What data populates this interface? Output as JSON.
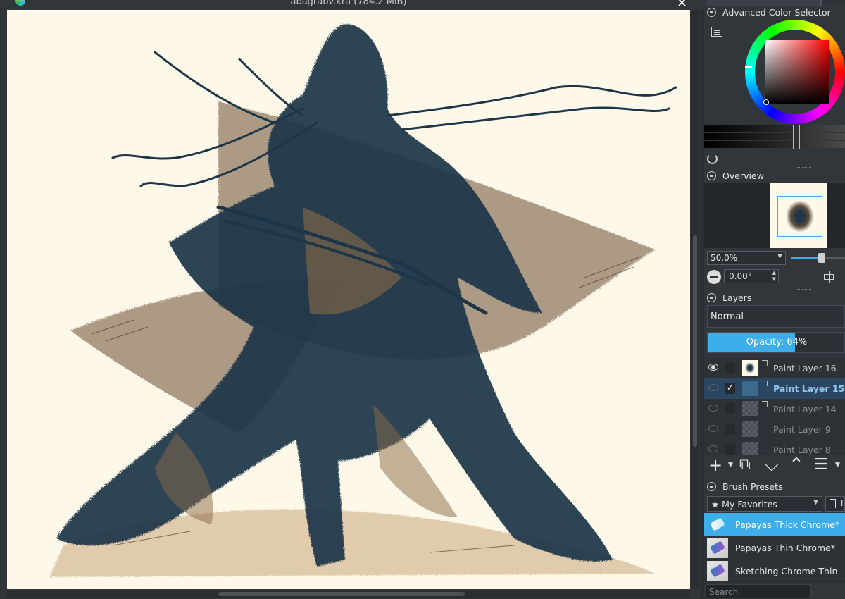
{
  "window": {
    "title": "abagrabv.kra (784.2 MiB)",
    "close_glyph": "✕"
  },
  "dock": {
    "color_selector": {
      "title": "Advanced Color Selector",
      "current_color": "#ff0000"
    },
    "overview": {
      "title": "Overview",
      "zoom": "50.0%",
      "zoom_fraction": 0.5,
      "rotation": "0.00°"
    },
    "layers": {
      "title": "Layers",
      "blend_mode": "Normal",
      "opacity_label": "Opacity:  64%",
      "opacity_value": 64,
      "items": [
        {
          "name": "Paint Layer 16",
          "visible": true,
          "selected": false
        },
        {
          "name": "Paint Layer 15",
          "visible": false,
          "selected": true
        },
        {
          "name": "Paint Layer 14",
          "visible": false,
          "selected": false
        },
        {
          "name": "Paint Layer 9",
          "visible": false,
          "selected": false
        },
        {
          "name": "Paint Layer 8",
          "visible": false,
          "selected": false
        }
      ],
      "toolbar": {
        "add": "+",
        "duplicate": "⧉",
        "move_down": "⌵",
        "move_up": "⌃",
        "properties": "☰"
      }
    },
    "brushes": {
      "title": "Brush Presets",
      "tag": "★ My Favorites",
      "tag_button": "T",
      "items": [
        {
          "name": "Papayas Thick Chrome*",
          "selected": true
        },
        {
          "name": "Papayas Thin Chrome*",
          "selected": false
        },
        {
          "name": "Sketching Chrome Thin",
          "selected": false
        }
      ],
      "search_placeholder": "Search"
    }
  },
  "colors": {
    "accent": "#3daee9",
    "canvas_bg": "#fdf8e7",
    "ink": "#1d3548",
    "sepia": "#6b4f36"
  }
}
